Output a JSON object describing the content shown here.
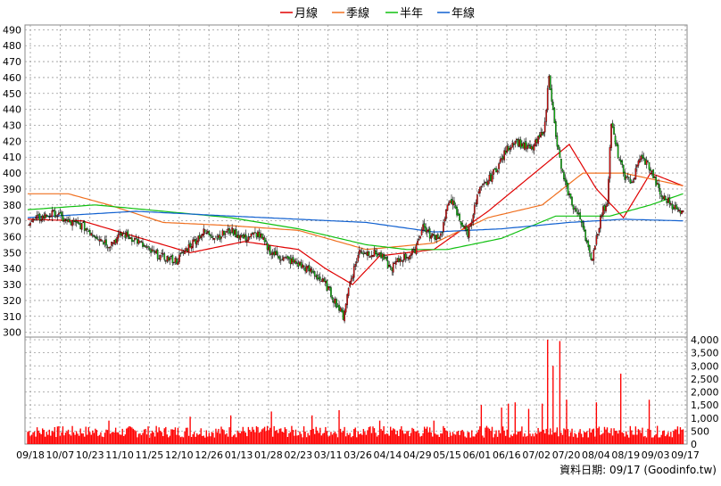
{
  "legend": [
    {
      "label": "月線",
      "color": "#e00000"
    },
    {
      "label": "季線",
      "color": "#f07020"
    },
    {
      "label": "半年",
      "color": "#10c010"
    },
    {
      "label": "年線",
      "color": "#1060d0"
    }
  ],
  "footer": "資料日期: 09/17  (Goodinfo.tw)",
  "colors": {
    "up": "#e01010",
    "down": "#10c010",
    "volume": "#ff0000",
    "grid": "#999999"
  },
  "chart_data": [
    {
      "type": "candlestick",
      "title": "",
      "ylim": [
        297,
        493
      ],
      "y_ticks": [
        300,
        310,
        320,
        330,
        340,
        350,
        360,
        370,
        380,
        390,
        400,
        410,
        420,
        430,
        440,
        450,
        460,
        470,
        480,
        490
      ],
      "x_tick_labels": [
        "09/18",
        "10/07",
        "10/23",
        "11/10",
        "11/25",
        "12/10",
        "12/26",
        "01/13",
        "01/28",
        "02/23",
        "03/11",
        "03/26",
        "04/14",
        "04/29",
        "05/15",
        "06/01",
        "06/16",
        "07/02",
        "07/20",
        "08/04",
        "08/19",
        "09/03",
        "09/17"
      ],
      "close_series_approx": [
        [
          0,
          369
        ],
        [
          10,
          372
        ],
        [
          20,
          375
        ],
        [
          30,
          369
        ],
        [
          40,
          367
        ],
        [
          50,
          361
        ],
        [
          60,
          355
        ],
        [
          70,
          362
        ],
        [
          80,
          358
        ],
        [
          90,
          351
        ],
        [
          100,
          347
        ],
        [
          110,
          345
        ],
        [
          120,
          355
        ],
        [
          130,
          363
        ],
        [
          140,
          360
        ],
        [
          150,
          364
        ],
        [
          160,
          359
        ],
        [
          170,
          362
        ],
        [
          180,
          350
        ],
        [
          190,
          346
        ],
        [
          200,
          343
        ],
        [
          210,
          338
        ],
        [
          220,
          330
        ],
        [
          228,
          318
        ],
        [
          233,
          310
        ],
        [
          238,
          332
        ],
        [
          245,
          351
        ],
        [
          252,
          350
        ],
        [
          260,
          349
        ],
        [
          268,
          340
        ],
        [
          275,
          346
        ],
        [
          285,
          350
        ],
        [
          292,
          367
        ],
        [
          298,
          360
        ],
        [
          305,
          361
        ],
        [
          312,
          385
        ],
        [
          318,
          372
        ],
        [
          325,
          362
        ],
        [
          333,
          388
        ],
        [
          340,
          395
        ],
        [
          347,
          404
        ],
        [
          354,
          415
        ],
        [
          360,
          421
        ],
        [
          366,
          417
        ],
        [
          372,
          415
        ],
        [
          378,
          422
        ],
        [
          382,
          430
        ],
        [
          385,
          463
        ],
        [
          390,
          422
        ],
        [
          396,
          395
        ],
        [
          403,
          379
        ],
        [
          410,
          368
        ],
        [
          416,
          344
        ],
        [
          420,
          360
        ],
        [
          424,
          375
        ],
        [
          428,
          382
        ],
        [
          431,
          432
        ],
        [
          434,
          418
        ],
        [
          438,
          405
        ],
        [
          442,
          396
        ],
        [
          447,
          395
        ],
        [
          452,
          410
        ],
        [
          458,
          406
        ],
        [
          462,
          398
        ],
        [
          468,
          385
        ],
        [
          474,
          382
        ],
        [
          480,
          376
        ],
        [
          484,
          378
        ]
      ],
      "moving_averages": [
        {
          "name": "月線",
          "points": [
            [
              0,
              371
            ],
            [
              40,
              370
            ],
            [
              80,
              360
            ],
            [
              120,
              350
            ],
            [
              160,
              357
            ],
            [
              200,
              352
            ],
            [
              220,
              340
            ],
            [
              240,
              330
            ],
            [
              260,
              348
            ],
            [
              300,
              352
            ],
            [
              340,
              376
            ],
            [
              380,
              404
            ],
            [
              400,
              418
            ],
            [
              420,
              390
            ],
            [
              440,
              372
            ],
            [
              460,
              400
            ],
            [
              484,
              392
            ]
          ]
        },
        {
          "name": "季線",
          "points": [
            [
              0,
              387
            ],
            [
              30,
              387
            ],
            [
              60,
              380
            ],
            [
              100,
              369
            ],
            [
              150,
              367
            ],
            [
              200,
              364
            ],
            [
              250,
              352
            ],
            [
              300,
              356
            ],
            [
              340,
              372
            ],
            [
              380,
              380
            ],
            [
              410,
              400
            ],
            [
              440,
              400
            ],
            [
              484,
              392
            ]
          ]
        },
        {
          "name": "半年",
          "points": [
            [
              0,
              377
            ],
            [
              50,
              380
            ],
            [
              100,
              376
            ],
            [
              150,
              372
            ],
            [
              200,
              365
            ],
            [
              250,
              355
            ],
            [
              280,
              352
            ],
            [
              310,
              352
            ],
            [
              350,
              359
            ],
            [
              390,
              373
            ],
            [
              430,
              373
            ],
            [
              460,
              380
            ],
            [
              484,
              387
            ]
          ]
        },
        {
          "name": "年線",
          "points": [
            [
              0,
              372
            ],
            [
              80,
              376
            ],
            [
              150,
              373
            ],
            [
              250,
              369
            ],
            [
              300,
              363
            ],
            [
              350,
              365
            ],
            [
              400,
              369
            ],
            [
              440,
              371
            ],
            [
              484,
              370
            ]
          ]
        }
      ]
    },
    {
      "type": "bar",
      "title": "",
      "ylim": [
        0,
        4000
      ],
      "y_ticks": [
        0,
        500,
        1000,
        1500,
        2000,
        2500,
        3000,
        3500,
        4000
      ],
      "y_tick_labels": [
        "0",
        "500",
        "1,000",
        "1,500",
        "2,000",
        "2,500",
        "3,000",
        "3,500",
        "4,000"
      ],
      "peaks": [
        [
          20,
          650
        ],
        [
          60,
          900
        ],
        [
          120,
          1050
        ],
        [
          150,
          1100
        ],
        [
          180,
          1250
        ],
        [
          210,
          1100
        ],
        [
          230,
          1300
        ],
        [
          260,
          900
        ],
        [
          300,
          900
        ],
        [
          335,
          1500
        ],
        [
          350,
          1400
        ],
        [
          355,
          1550
        ],
        [
          360,
          1600
        ],
        [
          370,
          1350
        ],
        [
          380,
          1550
        ],
        [
          384,
          4000
        ],
        [
          388,
          3000
        ],
        [
          393,
          3950
        ],
        [
          398,
          1700
        ],
        [
          420,
          1600
        ],
        [
          438,
          2700
        ],
        [
          459,
          1700
        ]
      ],
      "baseline": 500
    }
  ]
}
